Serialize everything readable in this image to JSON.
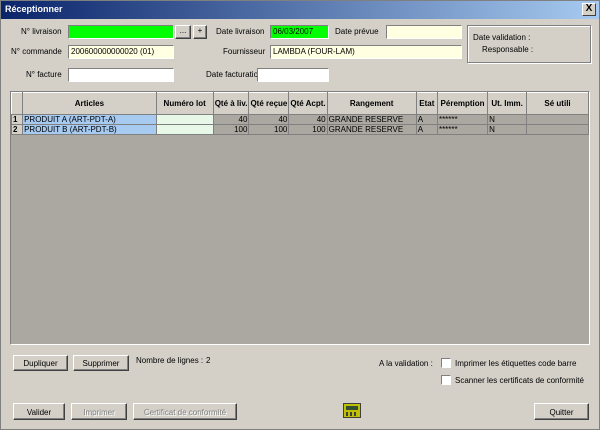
{
  "window": {
    "title": "Réceptionner",
    "close_label": "X"
  },
  "header": {
    "livraison_label": "N° livraison",
    "livraison_value": "",
    "browse_button": "...",
    "add_button": "+",
    "commande_label": "N° commande",
    "commande_value": "200600000000020 (01)",
    "facture_label": "N° facture",
    "facture_value": "",
    "date_livraison_label": "Date livraison",
    "date_livraison_value": "06/03/2007",
    "date_prevue_label": "Date prévue",
    "date_prevue_value": "",
    "fournisseur_label": "Fournisseur",
    "fournisseur_value": "LAMBDA (FOUR-LAM)",
    "date_facturation_label": "Date facturation",
    "date_facturation_value": "",
    "date_validation_label": "Date validation :",
    "responsable_label": "Responsable :"
  },
  "grid": {
    "columns": [
      "",
      "Articles",
      "Numéro lot",
      "Qté à liv.",
      "Qté reçue",
      "Qté Acpt.",
      "Rangement",
      "Etat",
      "Péremption",
      "Ut. Imm.",
      "Sé utili"
    ],
    "rows": [
      {
        "num": "1",
        "article": "PRODUIT A (ART-PDT-A)",
        "lot": "",
        "qte_liv": "40",
        "qte_recue": "40",
        "qte_acpt": "40",
        "rangement": "GRANDE RESERVE",
        "etat": "A",
        "peremption": "******",
        "ut_imm": "N",
        "se": ""
      },
      {
        "num": "2",
        "article": "PRODUIT B (ART-PDT-B)",
        "lot": "",
        "qte_liv": "100",
        "qte_recue": "100",
        "qte_acpt": "100",
        "rangement": "GRANDE RESERVE",
        "etat": "A",
        "peremption": "******",
        "ut_imm": "N",
        "se": ""
      }
    ]
  },
  "footer": {
    "dupliquer": "Dupliquer",
    "supprimer": "Supprimer",
    "nb_lignes_label": "Nombre de lignes :",
    "nb_lignes_value": "2",
    "a_la_validation": "A la validation :",
    "imprimer_etiquettes": "Imprimer les étiquettes code barre",
    "scanner_certificats": "Scanner les certificats de conformité",
    "valider": "Valider",
    "imprimer": "Imprimer",
    "certificat": "Certificat de conformité",
    "quitter": "Quitter"
  }
}
